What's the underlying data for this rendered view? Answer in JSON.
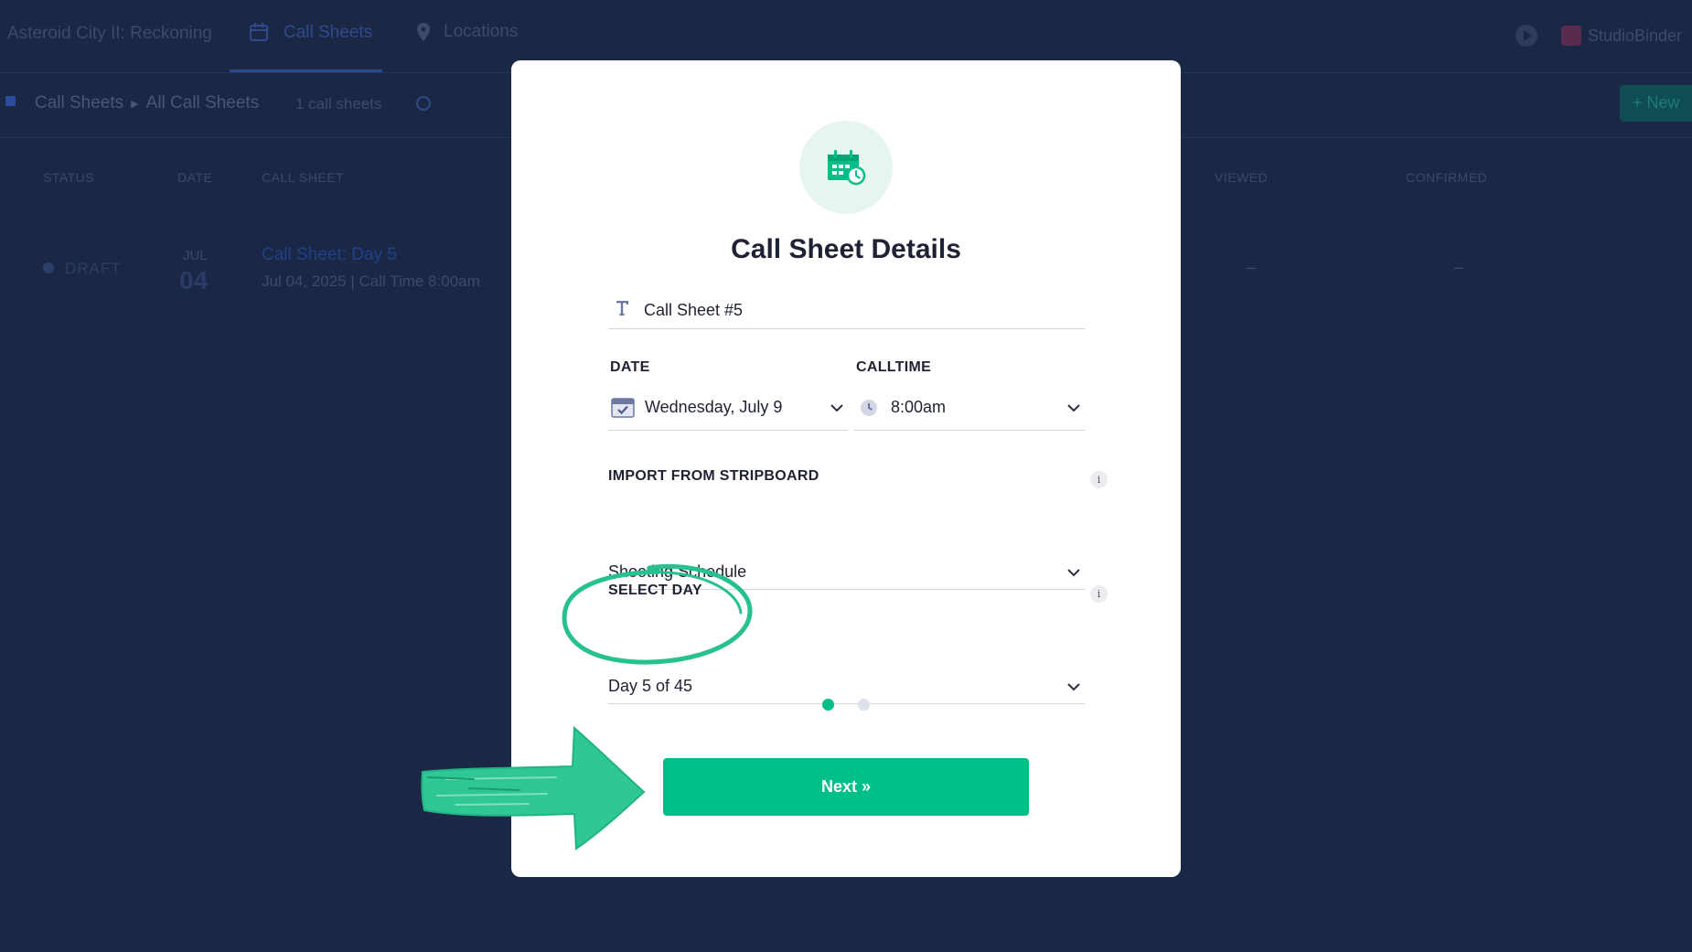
{
  "app": {
    "project_title": "Asteroid City II: Reckoning",
    "nav": {
      "call_sheets": "Call Sheets",
      "locations": "Locations"
    },
    "brand": "StudioBinder",
    "breadcrumb": {
      "root": "Call Sheets",
      "current": "All Call Sheets"
    },
    "sheet_count": "1 call sheets",
    "new_button": "+ New",
    "columns": {
      "status": "STATUS",
      "date": "DATE",
      "call_sheet": "CALL SHEET",
      "viewed": "VIEWED",
      "confirmed": "CONFIRMED"
    },
    "row": {
      "status": "DRAFT",
      "month": "JUL",
      "day": "04",
      "title": "Call Sheet: Day 5",
      "subtitle": "Jul 04, 2025 | Call Time 8:00am",
      "viewed": "–",
      "confirmed": "–"
    }
  },
  "modal": {
    "title": "Call Sheet Details",
    "name_value": "Call Sheet #5",
    "date_label": "DATE",
    "date_value": "Wednesday, July 9",
    "calltime_label": "CALLTIME",
    "calltime_value": "8:00am",
    "import_label": "IMPORT FROM STRIPBOARD",
    "import_value": "Shooting Schedule",
    "select_day_label": "SELECT DAY",
    "select_day_value": "Day 5 of 45",
    "info_glyph": "i",
    "pager": {
      "current": 1,
      "total": 2
    },
    "next_button": "Next »"
  },
  "colors": {
    "accent": "#00bf87",
    "annotation": "#27c08f",
    "backdrop": "#1a2846"
  }
}
